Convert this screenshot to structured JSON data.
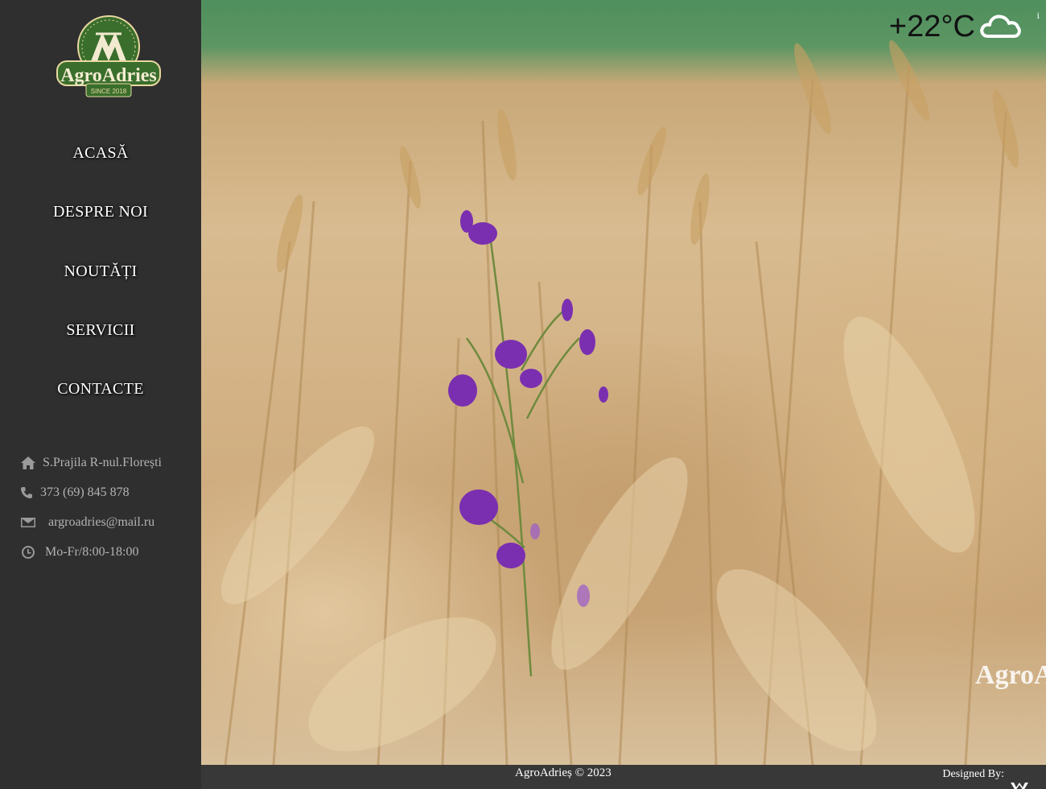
{
  "brand": {
    "name": "AgroAdries",
    "logo_tagline": "SINCE 2018",
    "colors": {
      "logo_green": "#3a6e2c",
      "logo_gold": "#e8d8a0",
      "sidebar": "#2f2f2f"
    }
  },
  "nav": {
    "items": [
      {
        "label": "ACASĂ"
      },
      {
        "label": "DESPRE NOI"
      },
      {
        "label": "NOUTĂȚI"
      },
      {
        "label": "SERVICII"
      },
      {
        "label": "CONTACTE"
      }
    ]
  },
  "contacts": {
    "address": {
      "icon": "home-icon",
      "text": "S.Prajila R-nul.Florești"
    },
    "phone": {
      "icon": "phone-icon",
      "text": "373 (69) 845 878"
    },
    "email": {
      "icon": "envelope-icon",
      "text": "argroadries@mail.ru"
    },
    "hours": {
      "icon": "clock-icon",
      "text": "Mo-Fr/8:00-18:00"
    }
  },
  "weather": {
    "temperature": "+22°C",
    "icon": "cloud-icon",
    "info": "i"
  },
  "hero": {
    "watermark": "AgroA"
  },
  "footer": {
    "copyright": "AgroAdrieș © 2023",
    "designed_by": "Designed By:"
  }
}
